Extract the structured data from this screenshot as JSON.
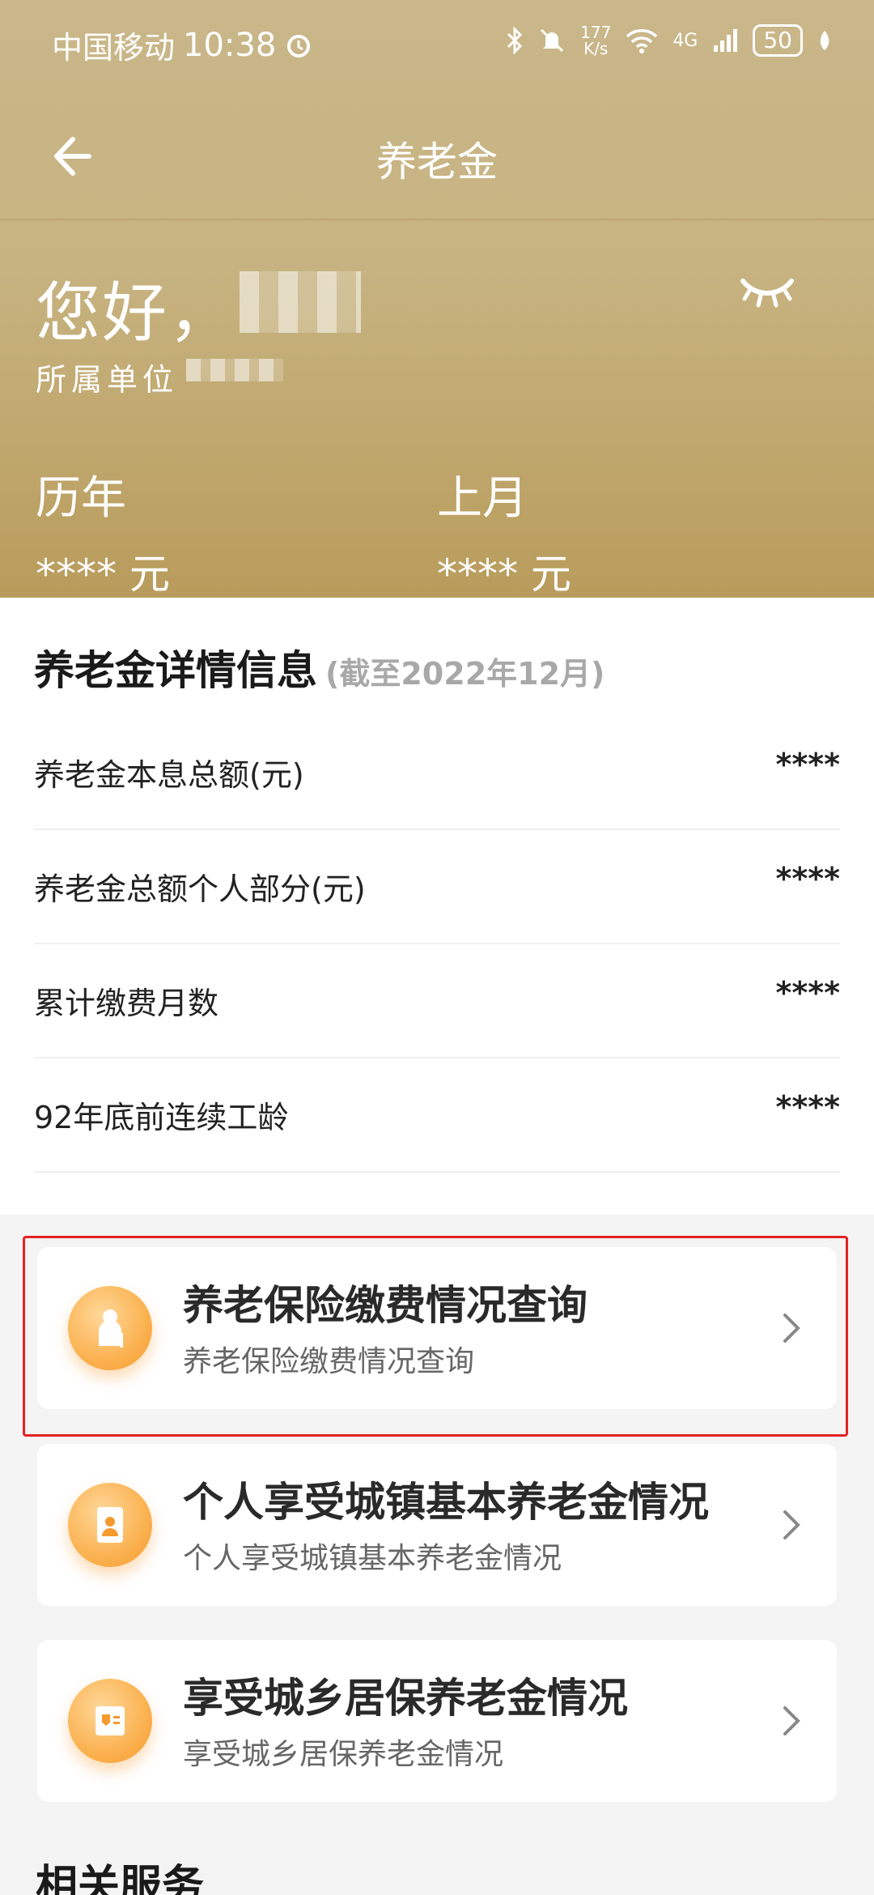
{
  "status_bar": {
    "carrier": "中国移动",
    "time": "10:38",
    "net_speed_top": "177",
    "net_speed_bottom": "K/s",
    "signal": "4G",
    "battery": "50"
  },
  "nav": {
    "title": "养老金"
  },
  "profile": {
    "greeting": "您好，",
    "unit_label": "所属单位"
  },
  "summary": {
    "history_label": "历年",
    "history_value": "**** 元",
    "last_month_label": "上月",
    "last_month_value": "**** 元"
  },
  "details": {
    "title": "养老金详情信息",
    "subtitle": "(截至2022年12月)",
    "rows": [
      {
        "label": "养老金本息总额(元)",
        "value": "****"
      },
      {
        "label": "养老金总额个人部分(元)",
        "value": "****"
      },
      {
        "label": "累计缴费月数",
        "value": "****"
      },
      {
        "label": "92年底前连续工龄",
        "value": "****"
      }
    ]
  },
  "cards": [
    {
      "title": "养老保险缴费情况查询",
      "subtitle": "养老保险缴费情况查询",
      "icon": "elderly-person-icon"
    },
    {
      "title": "个人享受城镇基本养老金情况",
      "subtitle": "个人享受城镇基本养老金情况",
      "icon": "person-card-icon"
    },
    {
      "title": "享受城乡居保养老金情况",
      "subtitle": "享受城乡居保养老金情况",
      "icon": "receipt-shield-icon"
    }
  ],
  "related": {
    "title": "相关服务"
  },
  "colors": {
    "header_gold": "#c9b78a",
    "accent_orange": "#fbb251",
    "highlight_red": "#e52222"
  }
}
